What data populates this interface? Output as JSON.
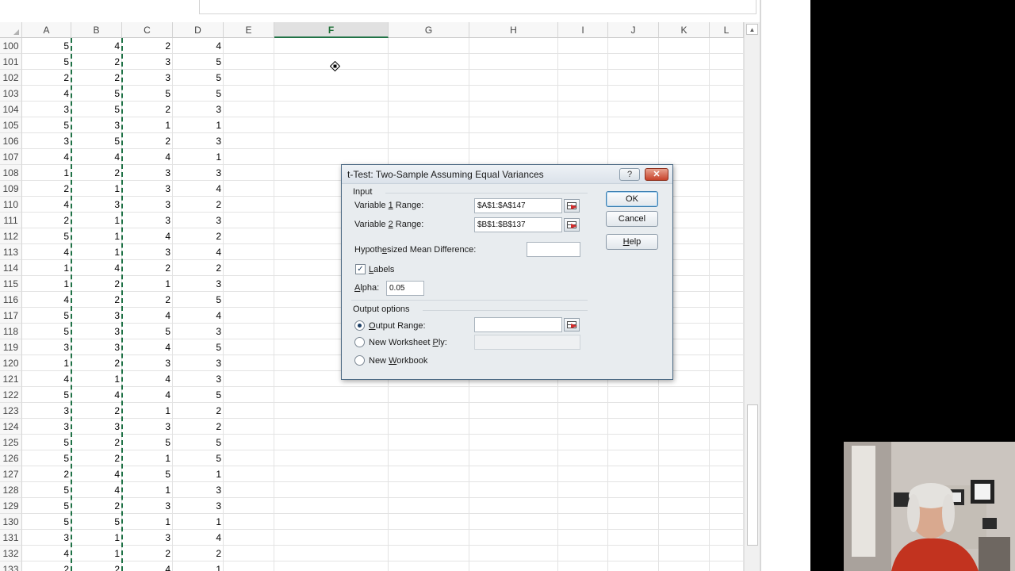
{
  "spreadsheet": {
    "columns": [
      "A",
      "B",
      "C",
      "D",
      "E",
      "F",
      "G",
      "H",
      "I",
      "J",
      "K",
      "L"
    ],
    "active_column": "F",
    "rows": [
      {
        "num": "100",
        "a": "5",
        "b": "4",
        "c": "2",
        "d": "4"
      },
      {
        "num": "101",
        "a": "5",
        "b": "2",
        "c": "3",
        "d": "5"
      },
      {
        "num": "102",
        "a": "2",
        "b": "2",
        "c": "3",
        "d": "5"
      },
      {
        "num": "103",
        "a": "4",
        "b": "5",
        "c": "5",
        "d": "5"
      },
      {
        "num": "104",
        "a": "3",
        "b": "5",
        "c": "2",
        "d": "3"
      },
      {
        "num": "105",
        "a": "5",
        "b": "3",
        "c": "1",
        "d": "1"
      },
      {
        "num": "106",
        "a": "3",
        "b": "5",
        "c": "2",
        "d": "3"
      },
      {
        "num": "107",
        "a": "4",
        "b": "4",
        "c": "4",
        "d": "1"
      },
      {
        "num": "108",
        "a": "1",
        "b": "2",
        "c": "3",
        "d": "3"
      },
      {
        "num": "109",
        "a": "2",
        "b": "1",
        "c": "3",
        "d": "4"
      },
      {
        "num": "110",
        "a": "4",
        "b": "3",
        "c": "3",
        "d": "2"
      },
      {
        "num": "111",
        "a": "2",
        "b": "1",
        "c": "3",
        "d": "3"
      },
      {
        "num": "112",
        "a": "5",
        "b": "1",
        "c": "4",
        "d": "2"
      },
      {
        "num": "113",
        "a": "4",
        "b": "1",
        "c": "3",
        "d": "4"
      },
      {
        "num": "114",
        "a": "1",
        "b": "4",
        "c": "2",
        "d": "2"
      },
      {
        "num": "115",
        "a": "1",
        "b": "2",
        "c": "1",
        "d": "3"
      },
      {
        "num": "116",
        "a": "4",
        "b": "2",
        "c": "2",
        "d": "5"
      },
      {
        "num": "117",
        "a": "5",
        "b": "3",
        "c": "4",
        "d": "4"
      },
      {
        "num": "118",
        "a": "5",
        "b": "3",
        "c": "5",
        "d": "3"
      },
      {
        "num": "119",
        "a": "3",
        "b": "3",
        "c": "4",
        "d": "5"
      },
      {
        "num": "120",
        "a": "1",
        "b": "2",
        "c": "3",
        "d": "3"
      },
      {
        "num": "121",
        "a": "4",
        "b": "1",
        "c": "4",
        "d": "3"
      },
      {
        "num": "122",
        "a": "5",
        "b": "4",
        "c": "4",
        "d": "5"
      },
      {
        "num": "123",
        "a": "3",
        "b": "2",
        "c": "1",
        "d": "2"
      },
      {
        "num": "124",
        "a": "3",
        "b": "3",
        "c": "3",
        "d": "2"
      },
      {
        "num": "125",
        "a": "5",
        "b": "2",
        "c": "5",
        "d": "5"
      },
      {
        "num": "126",
        "a": "5",
        "b": "2",
        "c": "1",
        "d": "5"
      },
      {
        "num": "127",
        "a": "2",
        "b": "4",
        "c": "5",
        "d": "1"
      },
      {
        "num": "128",
        "a": "5",
        "b": "4",
        "c": "1",
        "d": "3"
      },
      {
        "num": "129",
        "a": "5",
        "b": "2",
        "c": "3",
        "d": "3"
      },
      {
        "num": "130",
        "a": "5",
        "b": "5",
        "c": "1",
        "d": "1"
      },
      {
        "num": "131",
        "a": "3",
        "b": "1",
        "c": "3",
        "d": "4"
      },
      {
        "num": "132",
        "a": "4",
        "b": "1",
        "c": "2",
        "d": "2"
      },
      {
        "num": "133",
        "a": "2",
        "b": "2",
        "c": "4",
        "d": "1"
      }
    ]
  },
  "dialog": {
    "title": "t-Test: Two-Sample Assuming Equal Variances",
    "help_glyph": "?",
    "close_glyph": "✕",
    "input_section": "Input",
    "var1_label_pre": "Variable ",
    "var1_label_key": "1",
    "var1_label_post": " Range:",
    "var1_value": "$A$1:$A$147",
    "var2_label_pre": "Variable ",
    "var2_label_key": "2",
    "var2_label_post": " Range:",
    "var2_value": "$B$1:$B$137",
    "hyp_label_pre": "Hypoth",
    "hyp_label_key": "e",
    "hyp_label_post": "sized Mean Difference:",
    "hyp_value": "",
    "labels_checked_glyph": "✓",
    "labels_key": "L",
    "labels_rest": "abels",
    "alpha_key": "A",
    "alpha_rest": "lpha:",
    "alpha_value": "0.05",
    "output_section": "Output options",
    "out_range_key": "O",
    "out_range_rest": "utput Range:",
    "out_range_value": "",
    "new_ply_pre": "New Worksheet ",
    "new_ply_key": "P",
    "new_ply_post": "ly:",
    "new_wb_pre": "New ",
    "new_wb_key": "W",
    "new_wb_post": "orkbook",
    "ok": "OK",
    "cancel": "Cancel",
    "help": "Help",
    "help_key": "H",
    "help_rest": "elp"
  },
  "colors": {
    "accent_green": "#217346",
    "copy_marquee": "#1e7145"
  },
  "icons": {
    "cursor": "move-cursor-icon",
    "range_picker": "collapse-dialog-icon"
  }
}
